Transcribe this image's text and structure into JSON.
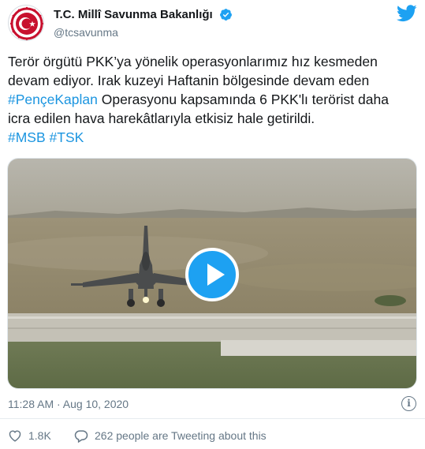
{
  "tweet": {
    "author": {
      "display_name": "T.C. Millî Savunma Bakanlığı",
      "handle": "@tcsavunma",
      "verified": true,
      "avatar_icon": "turkish-ministry-emblem-icon"
    },
    "brand_icon": "twitter-bird-icon",
    "text": {
      "line1": "Terör örgütü PKK’ya yönelik operasyonlarımız hız kesmeden",
      "line2": "devam ediyor. Irak kuzeyi Haftanin bölgesinde devam eden",
      "line3_hashtag": "#PençeKaplan",
      "line3_rest": " Operasyonu kapsamında 6 PKK'lı terörist daha",
      "line4": "icra edilen hava harekâtlarıyla etkisiz hale getirildi.",
      "hashtags": [
        "#MSB",
        "#TSK"
      ]
    },
    "media": {
      "type": "video",
      "play_icon": "play-icon"
    },
    "timestamp": "11:28 AM · Aug 10, 2020",
    "info_icon_label": "i",
    "likes_count": "1.8K",
    "reply_label": "262 people are Tweeting about this"
  },
  "colors": {
    "link": "#1b95e0",
    "brand_blue": "#1da1f2",
    "secondary_text": "#657786",
    "primary_text": "#14171a",
    "emblem_red": "#c8102e"
  }
}
